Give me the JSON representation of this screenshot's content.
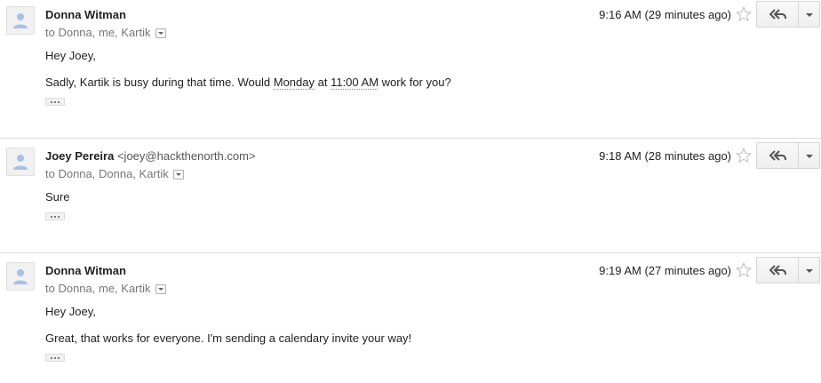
{
  "messages": [
    {
      "sender_name": "Donna Witman",
      "sender_email": "",
      "recipients": "to Donna, me, Kartik",
      "timestamp": "9:16 AM (29 minutes ago)",
      "greeting": "Hey Joey,",
      "body_pre": "Sadly, Kartik is busy during that time. Would ",
      "body_u1": "Monday",
      "body_mid": " at ",
      "body_u2": "11:00 AM",
      "body_post": " work for you?"
    },
    {
      "sender_name": "Joey Pereira",
      "sender_email": "<joey@hackthenorth.com>",
      "recipients": "to Donna, Donna, Kartik",
      "timestamp": "9:18 AM (28 minutes ago)",
      "body": "Sure"
    },
    {
      "sender_name": "Donna Witman",
      "sender_email": "",
      "recipients": "to Donna, me, Kartik",
      "timestamp": "9:19 AM (27 minutes ago)",
      "greeting": "Hey Joey,",
      "body": "Great, that works for everyone. I'm sending a calendary invite your way!"
    }
  ],
  "icons": {
    "avatar": "default-person-avatar-icon",
    "star": "star-outline-icon",
    "reply": "reply-all-icon",
    "more": "chevron-down-icon",
    "show_trimmed": "ellipsis-icon"
  },
  "colors": {
    "avatar_figure": "#a9c0e6",
    "divider": "#dadada",
    "secondary_text": "#777777"
  }
}
